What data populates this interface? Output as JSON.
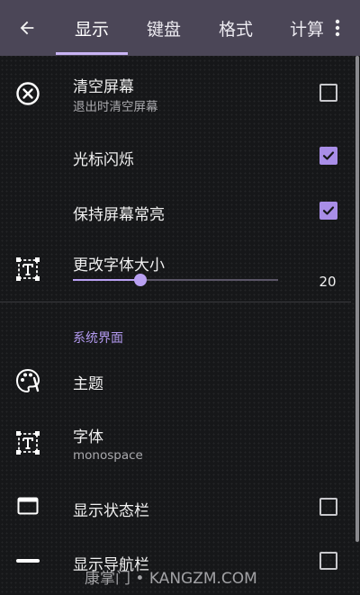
{
  "toolbar": {
    "back_icon": "arrow-left-icon",
    "overflow_icon": "more-vert-icon",
    "tabs": [
      {
        "label": "显示",
        "active": true
      },
      {
        "label": "键盘",
        "active": false
      },
      {
        "label": "格式",
        "active": false
      },
      {
        "label": "计算",
        "active": false
      }
    ],
    "colors": {
      "bar": "#4b4657",
      "indicator": "#c9b4f5"
    }
  },
  "settings": {
    "clear_screen": {
      "title": "清空屏幕",
      "subtitle": "退出时清空屏幕",
      "checked": false,
      "icon": "close-circle-icon"
    },
    "cursor_blink": {
      "title": "光标闪烁",
      "checked": true
    },
    "keep_screen_on": {
      "title": "保持屏幕常亮",
      "checked": true
    },
    "font_size": {
      "title": "更改字体大小",
      "value": "20",
      "level": 0.33,
      "icon": "text-box-icon"
    },
    "section_system_ui": "系统界面",
    "theme": {
      "title": "主题",
      "icon": "palette-icon"
    },
    "font": {
      "title": "字体",
      "subtitle": "monospace",
      "icon": "text-box-icon"
    },
    "show_status_bar": {
      "title": "显示状态栏",
      "checked": false,
      "icon": "window-icon"
    },
    "show_nav_bar": {
      "title": "显示导航栏",
      "checked": false,
      "icon": "minus-icon"
    }
  },
  "colors": {
    "accent": "#a98ee8",
    "section": "#b39af0",
    "background": "#161719"
  },
  "watermark": "康掌门 • KANGZM.COM"
}
